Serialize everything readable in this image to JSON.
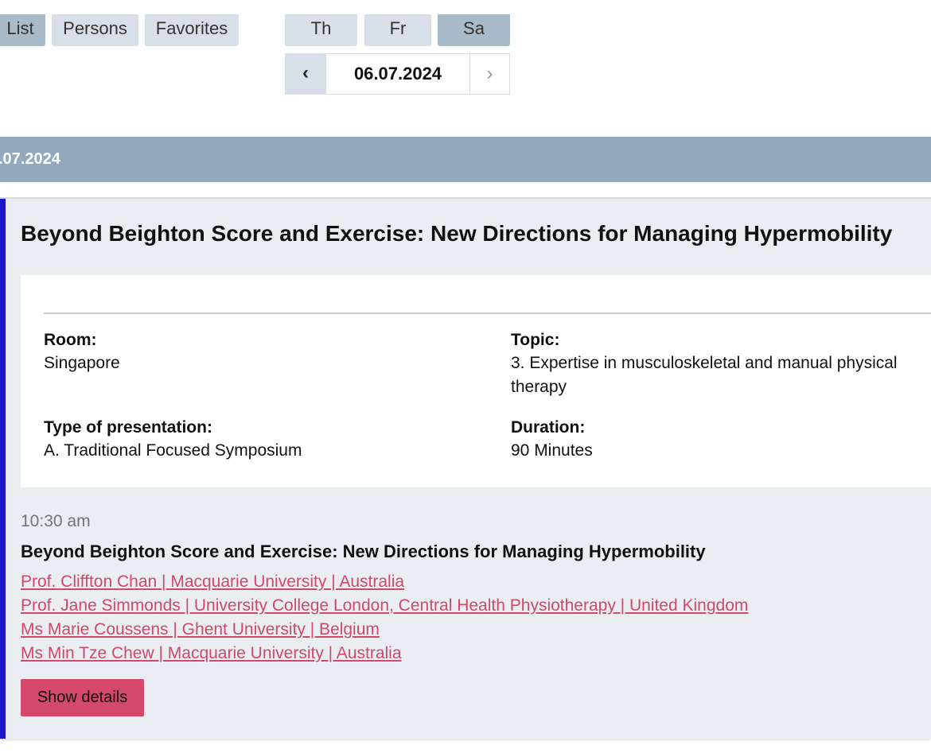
{
  "view_tabs": {
    "list": "List",
    "persons": "Persons",
    "favorites": "Favorites"
  },
  "day_tabs": {
    "th": "Th",
    "fr": "Fr",
    "sa": "Sa"
  },
  "date_pager": {
    "prev": "‹",
    "current": "06.07.2024",
    "next": "›"
  },
  "date_header": ".07.2024",
  "session": {
    "title": "Beyond Beighton Score and Exercise: New Directions for Managing Hypermobility",
    "room_label": "Room:",
    "room_value": "Singapore",
    "topic_label": "Topic:",
    "topic_value": "3. Expertise in musculoskeletal and manual physical therapy",
    "type_label": "Type of presentation:",
    "type_value": "A. Traditional Focused Symposium",
    "duration_label": "Duration:",
    "duration_value": "90 Minutes",
    "time": "10:30 am",
    "talk_title": "Beyond Beighton Score and Exercise: New Directions for Managing Hypermobility",
    "speakers": [
      "Prof. Cliffton Chan | Macquarie University | Australia",
      "Prof. Jane Simmonds | University College London, Central Health Physiotherapy | United Kingdom",
      "Ms Marie Coussens | Ghent University | Belgium",
      "Ms Min Tze Chew | Macquarie University | Australia"
    ],
    "details_button": "Show details"
  },
  "colors": {
    "accent_bar": "#1c16c4",
    "date_bar": "#94a9bd",
    "link": "#d0486a",
    "button": "#d4486b"
  }
}
